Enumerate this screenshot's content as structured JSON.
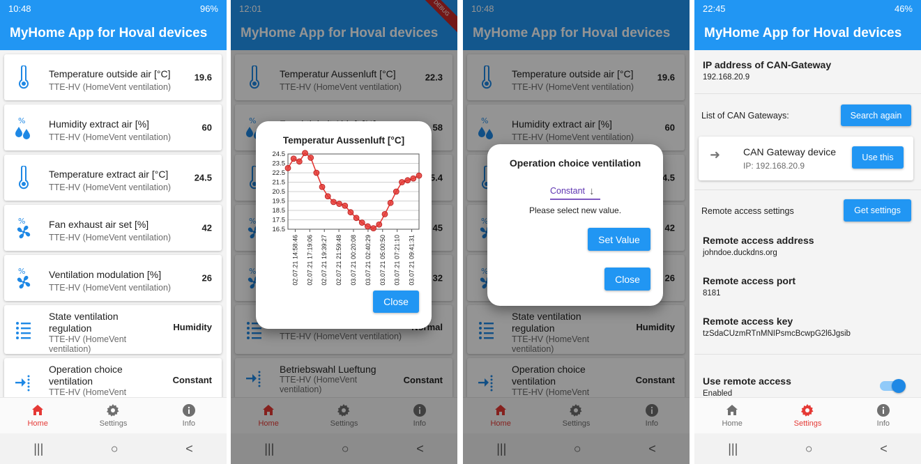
{
  "common": {
    "app_title": "MyHome App for Hoval devices",
    "nav": {
      "home": "Home",
      "settings": "Settings",
      "info": "Info"
    },
    "sysnav": {
      "recents": "|||",
      "home": "○",
      "back": "<"
    }
  },
  "phone1": {
    "time": "10:48",
    "battery": "96%",
    "cards": [
      {
        "title": "Temperature outside air [°C]",
        "sub": "TTE-HV (HomeVent ventilation)",
        "value": "19.6",
        "icon": "thermometer-icon"
      },
      {
        "title": "Humidity extract air [%]",
        "sub": "TTE-HV (HomeVent ventilation)",
        "value": "60",
        "icon": "humidity-icon"
      },
      {
        "title": "Temperature extract air [°C]",
        "sub": "TTE-HV (HomeVent ventilation)",
        "value": "24.5",
        "icon": "thermometer-icon"
      },
      {
        "title": "Fan exhaust air set [%]",
        "sub": "TTE-HV (HomeVent ventilation)",
        "value": "42",
        "icon": "fan-icon"
      },
      {
        "title": "Ventilation modulation [%]",
        "sub": "TTE-HV (HomeVent ventilation)",
        "value": "26",
        "icon": "fan-icon"
      },
      {
        "title": "State ventilation regulation",
        "sub": "TTE-HV (HomeVent ventilation)",
        "value": "Humidity",
        "icon": "list-icon"
      },
      {
        "title": "Operation choice ventilation",
        "sub": "TTE-HV (HomeVent ventilation)",
        "value": "Constant",
        "icon": "input-icon"
      }
    ]
  },
  "phone2": {
    "time": "12:01",
    "debug": "DEBUG",
    "cards": [
      {
        "title": "Temperatur Aussenluft [°C]",
        "sub": "TTE-HV (HomeVent ventilation)",
        "value": "22.3"
      },
      {
        "title": "Feuchtigkeit Abluft [%]",
        "value": "58"
      },
      {
        "value": "25.4"
      },
      {
        "value": "45"
      },
      {
        "value": "32"
      },
      {
        "sub": "TTE-HV (HomeVent ventilation)",
        "value": "Normal"
      },
      {
        "title": "Betriebswahl Lueftung",
        "sub": "TTE-HV (HomeVent ventilation)",
        "value": "Constant"
      }
    ],
    "dialog": {
      "close": "Close"
    }
  },
  "chart_data": {
    "type": "line",
    "title": "Temperatur Aussenluft [°C]",
    "ylim": [
      16.5,
      24.5
    ],
    "yticks": [
      "24.5",
      "23.5",
      "22.5",
      "21.5",
      "20.5",
      "19.5",
      "18.5",
      "17.5",
      "16.5"
    ],
    "xticks": [
      "02.07.21 14:58:46",
      "02.07.21 17:19:06",
      "02.07.21 19:39:27",
      "02.07.21 21:59:48",
      "03.07.21 00:20:08",
      "03.07.21 02:40:29",
      "03.07.21 05:00:50",
      "03.07.21 07:21:10",
      "03.07.21 09:41:31"
    ],
    "series": [
      {
        "values": [
          23.0,
          24.0,
          23.7,
          24.6,
          24.1,
          22.5,
          21.0,
          20.0,
          19.4,
          19.2,
          19.0,
          18.3,
          17.7,
          17.2,
          16.8,
          16.6,
          17.0,
          18.1,
          19.3,
          20.5,
          21.5,
          21.7,
          21.9,
          22.2
        ]
      }
    ],
    "grid": true
  },
  "phone3": {
    "time": "10:48",
    "cards": [
      {
        "title": "Temperature outside air [°C]",
        "sub": "TTE-HV (HomeVent ventilation)",
        "value": "19.6"
      },
      {
        "title": "Humidity extract air [%]",
        "sub": "TTE-HV (HomeVent ventilation)",
        "value": "60"
      },
      {
        "value": "24.5"
      },
      {
        "value": "42"
      },
      {
        "value": "26"
      },
      {
        "title": "State ventilation regulation",
        "sub": "TTE-HV (HomeVent ventilation)",
        "value": "Humidity"
      },
      {
        "title": "Operation choice ventilation",
        "sub": "TTE-HV (HomeVent ventilation)",
        "value": "Constant"
      }
    ],
    "dialog": {
      "title": "Operation choice ventilation",
      "selected": "Constant",
      "hint": "Please select new value.",
      "set_value": "Set Value",
      "close": "Close"
    }
  },
  "phone4": {
    "time": "22:45",
    "battery": "46%",
    "ip_label": "IP address of CAN-Gateway",
    "ip_value": "192.168.20.9",
    "list_label": "List of CAN Gateways:",
    "search_again": "Search again",
    "gateway_name": "CAN Gateway device",
    "gateway_ip": "IP: 192.168.20.9",
    "use_this": "Use this",
    "remote_settings_label": "Remote access settings",
    "get_settings": "Get settings",
    "remote_address_label": "Remote access address",
    "remote_address_value": "johndoe.duckdns.org",
    "remote_port_label": "Remote access port",
    "remote_port_value": "8181",
    "remote_key_label": "Remote access key",
    "remote_key_value": "tzSdaCUzmRTnMNIPsmcBcwpG2l6Jgsib",
    "use_remote_label": "Use remote access",
    "use_remote_value": "Enabled",
    "use_remote_on": true
  },
  "colors": {
    "primary": "#2196f3",
    "active_nav": "#e53935",
    "chart_point": "#e53935"
  }
}
